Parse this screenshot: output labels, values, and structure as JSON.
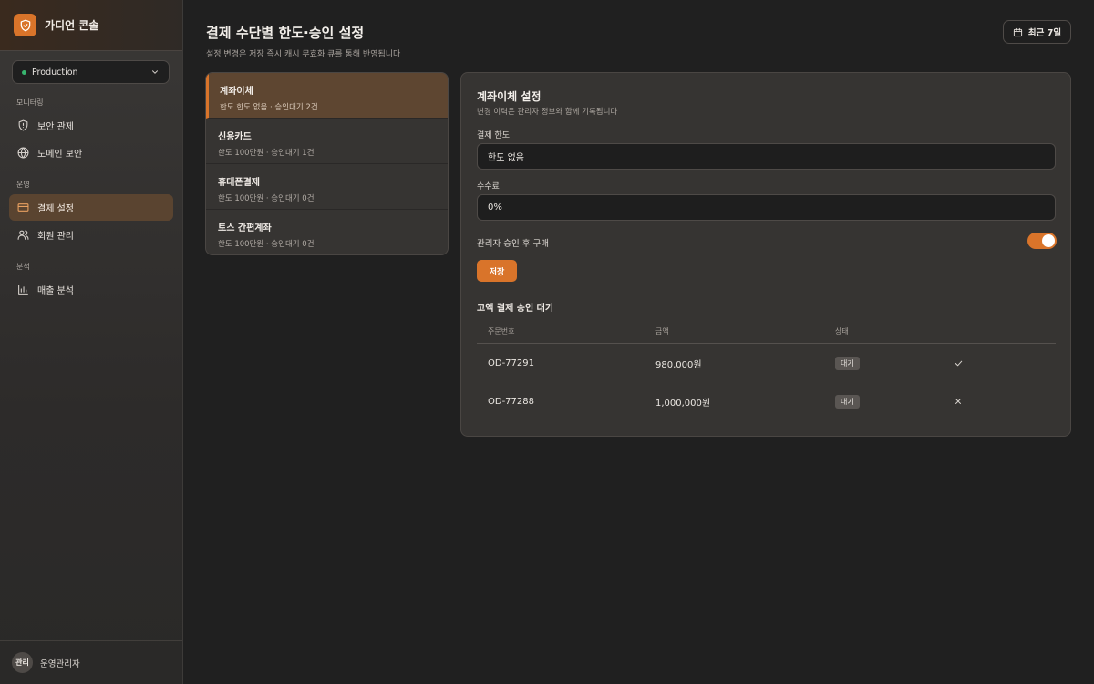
{
  "app": {
    "title": "가디언 콘솔"
  },
  "environment": {
    "selected": "Production",
    "status_color": "#38b56f"
  },
  "sidebar": {
    "sections": [
      {
        "title": "모니터링"
      },
      {
        "title": "운영"
      },
      {
        "title": "분석"
      }
    ],
    "items": [
      {
        "label": "보안 관제",
        "icon": "shield-icon"
      },
      {
        "label": "도메인 보안",
        "icon": "globe-icon"
      },
      {
        "label": "결제 설정",
        "icon": "credit-card-icon",
        "active": true
      },
      {
        "label": "회원 관리",
        "icon": "users-icon"
      },
      {
        "label": "매출 분석",
        "icon": "bar-chart-icon"
      }
    ],
    "footer": {
      "avatar": "관리",
      "name": "운영관리자"
    }
  },
  "header": {
    "title": "결제 수단별 한도·승인 설정",
    "subtitle": "설정 변경은 저장 즉시 캐시 무효화 큐를 통해 반영됩니다",
    "range_label": "최근 7일"
  },
  "methods": [
    {
      "name": "계좌이체",
      "desc": "한도 한도 없음 · 승인대기 2건",
      "active": true
    },
    {
      "name": "신용카드",
      "desc": "한도 100만원 · 승인대기 1건"
    },
    {
      "name": "휴대폰결제",
      "desc": "한도 100만원 · 승인대기 0건"
    },
    {
      "name": "토스 간편계좌",
      "desc": "한도 100만원 · 승인대기 0건"
    }
  ],
  "panel": {
    "title": "계좌이체 설정",
    "subtitle": "변경 이력은 관리자 정보와 함께 기록됩니다",
    "limit_label": "결제 한도",
    "limit_value": "한도 없음",
    "fee_label": "수수료",
    "fee_value": "0%",
    "approval_label": "관리자 승인 후 구매",
    "approval_enabled": true,
    "save_label": "저장",
    "queue_title": "고액 결제 승인 대기",
    "columns": [
      "주문번호",
      "금액",
      "상태"
    ],
    "rows": [
      {
        "order": "OD-77291",
        "amount": "980,000원",
        "status": "대기",
        "action": "check-icon"
      },
      {
        "order": "OD-77288",
        "amount": "1,000,000원",
        "status": "대기",
        "action": "x-icon"
      }
    ]
  },
  "colors": {
    "accent": "#d9742a",
    "active_bg": "#5a4430",
    "background": "#202020"
  }
}
